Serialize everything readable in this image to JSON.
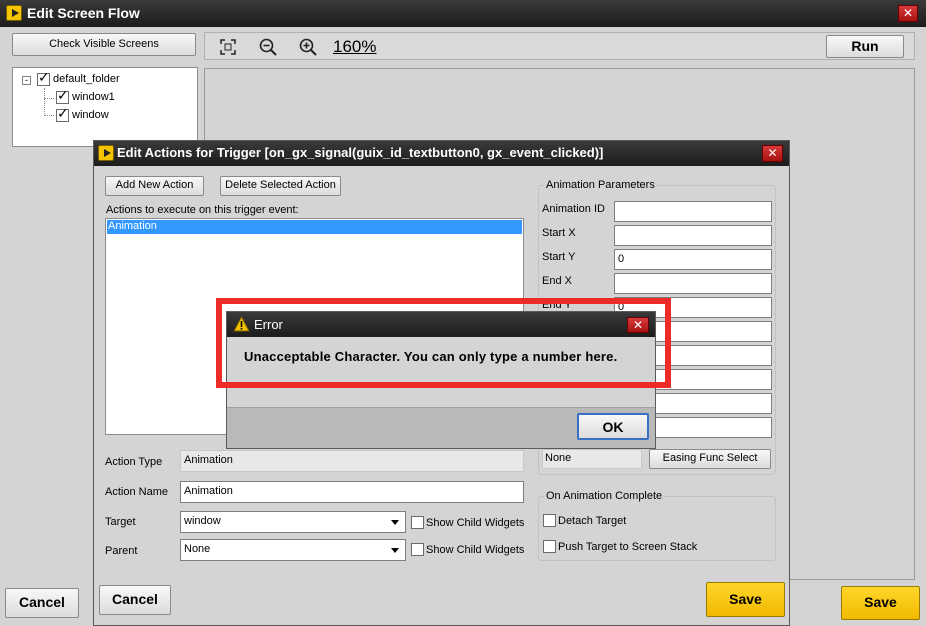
{
  "main_window": {
    "title": "Edit Screen Flow",
    "check_visible_screens": "Check Visible Screens",
    "zoom_level": "160%",
    "run_label": "Run",
    "cancel_label": "Cancel",
    "save_label": "Save",
    "tree": [
      {
        "label": "default_folder",
        "checked": true
      },
      {
        "label": "window1",
        "checked": true
      },
      {
        "label": "window",
        "checked": true
      }
    ]
  },
  "actions_dialog": {
    "title": "Edit Actions for Trigger [on_gx_signal(guix_id_textbutton0, gx_event_clicked)]",
    "add_new_action": "Add New Action",
    "delete_selected_action": "Delete Selected Action",
    "actions_label": "Actions to execute on this trigger event:",
    "actions": [
      "Animation"
    ],
    "action_type_label": "Action Type",
    "action_type_value": "Animation",
    "action_name_label": "Action Name",
    "action_name_value": "Animation",
    "target_label": "Target",
    "target_value": "window",
    "parent_label": "Parent",
    "parent_value": "None",
    "show_child_widgets": "Show Child Widgets",
    "animation_params_title": "Animation Parameters",
    "params": [
      {
        "label": "Animation ID",
        "value": ""
      },
      {
        "label": "Start X",
        "value": ""
      },
      {
        "label": "Start Y",
        "value": "0"
      },
      {
        "label": "End X",
        "value": ""
      },
      {
        "label": "End Y",
        "value": "0"
      }
    ],
    "easing_value": "None",
    "easing_select": "Easing Func Select",
    "on_complete_title": "On Animation Complete",
    "detach_target": "Detach Target",
    "push_target": "Push Target to Screen Stack",
    "cancel_label": "Cancel",
    "save_label": "Save"
  },
  "error_dialog": {
    "title": "Error",
    "message": "Unacceptable Character. You can only type a number here.",
    "ok_label": "OK",
    "highlight_color": "#ee2b2b"
  }
}
